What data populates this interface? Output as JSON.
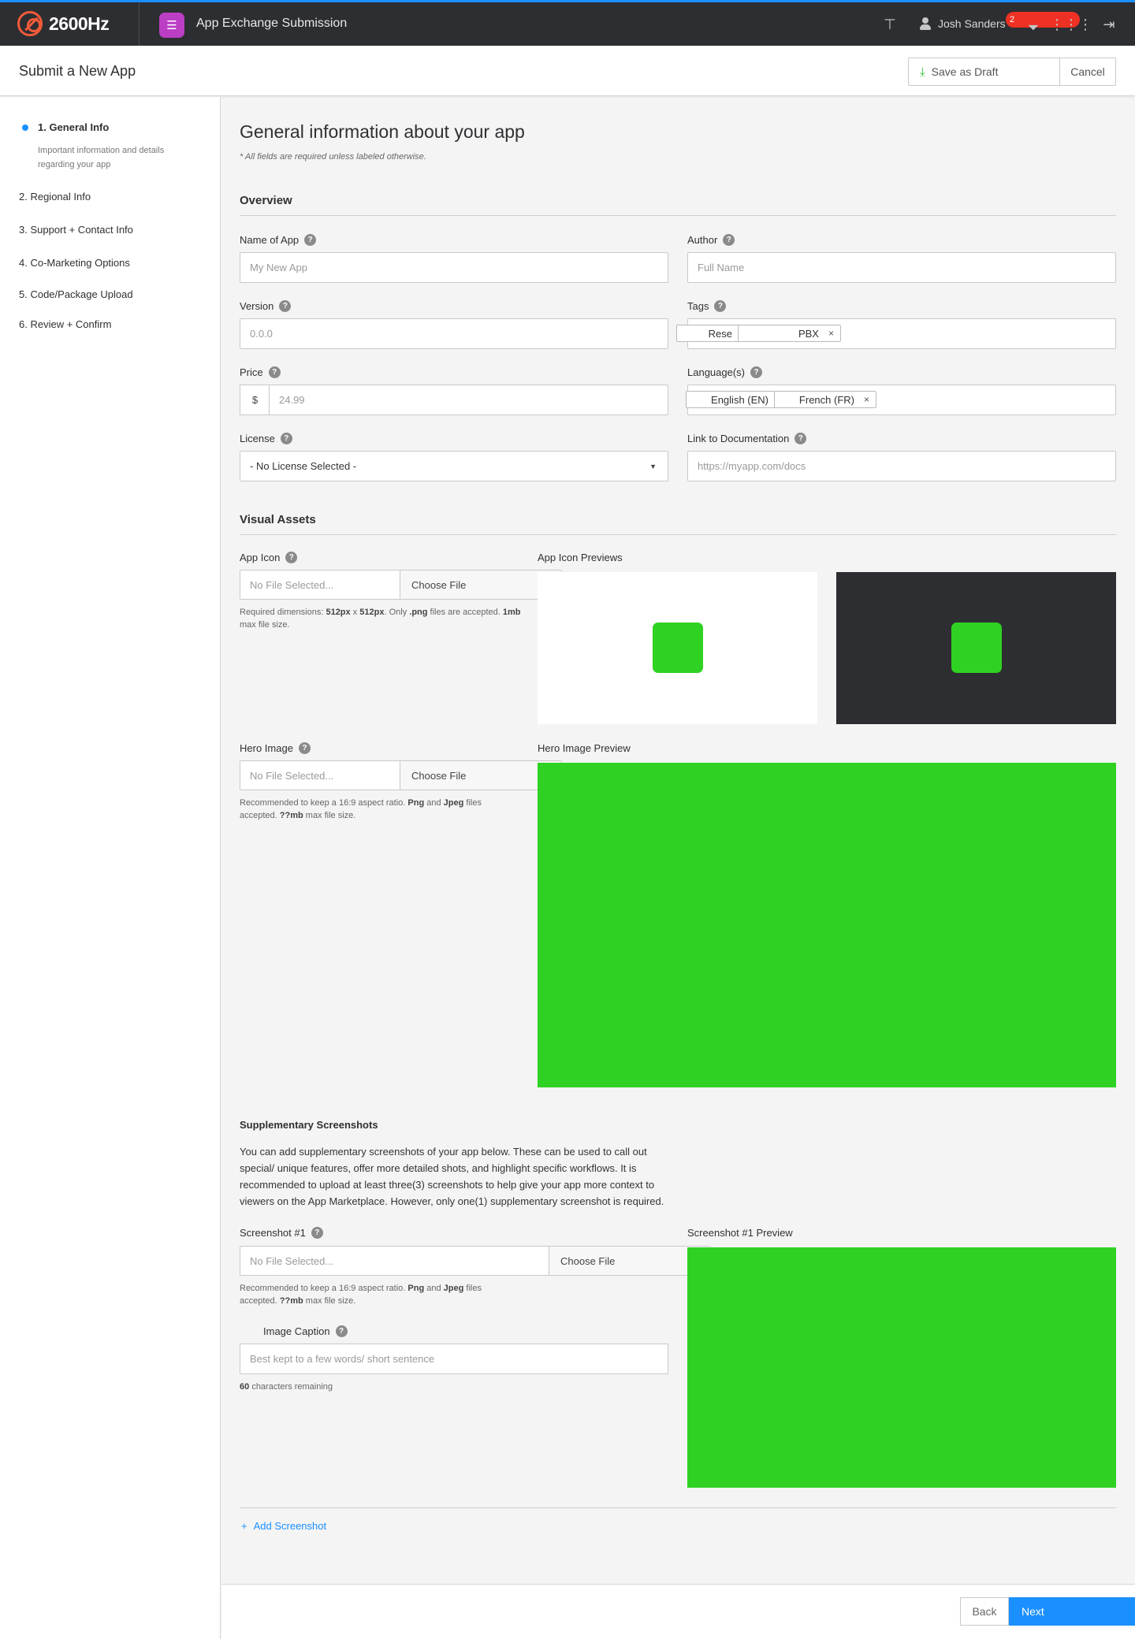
{
  "topbar": {
    "logo_text": "2600Hz",
    "app_title": "App Exchange Submission",
    "user_name": "Josh Sanders",
    "notification_count": "2"
  },
  "subheader": {
    "title": "Submit a New App",
    "save_draft": "Save as Draft",
    "cancel": "Cancel"
  },
  "steps": [
    {
      "label": "1. General Info",
      "description": "Important information and details regarding your app"
    },
    {
      "label": "2. Regional Info"
    },
    {
      "label": "3. Support + Contact Info"
    },
    {
      "label": "4. Co-Marketing Options"
    },
    {
      "label": "5. Code/Package Upload"
    },
    {
      "label": "6. Review + Confirm"
    }
  ],
  "main": {
    "title": "General information about your app",
    "note": "* All fields are required unless labeled otherwise."
  },
  "overview": {
    "heading": "Overview",
    "name_label": "Name of App",
    "name_placeholder": "My New App",
    "author_label": "Author",
    "author_placeholder": "Full Name",
    "version_label": "Version",
    "version_placeholder": "0.0.0",
    "tags_label": "Tags",
    "tags": [
      "Rese",
      "PBX"
    ],
    "price_label": "Price",
    "price_prefix": "$",
    "price_placeholder": "24.99",
    "languages_label": "Language(s)",
    "languages": [
      "English (EN)",
      "French (FR)"
    ],
    "license_label": "License",
    "license_value": "- No License Selected -",
    "docs_label": "Link to Documentation",
    "docs_placeholder": "https://myapp.com/docs"
  },
  "visual": {
    "heading": "Visual Assets",
    "app_icon_label": "App Icon",
    "no_file": "No File Selected...",
    "choose_file": "Choose File",
    "app_icon_previews_label": "App Icon Previews",
    "hero_label": "Hero Image",
    "hero_preview_label": "Hero Image Preview",
    "preview_color": "#2fd222"
  },
  "supplementary": {
    "heading": "Supplementary Screenshots",
    "description": "You can add supplementary screenshots of your app below. These can be used to call out special/ unique features,  offer more detailed shots, and highlight specific workflows. It is recommended to upload at least three(3) screenshots to help give your app more context to viewers on the App Marketplace. However, only one(1) supplementary screenshot is required.",
    "screenshot_label": "Screenshot #1",
    "screenshot_preview_label": "Screenshot #1 Preview",
    "caption_label": "Image Caption",
    "caption_placeholder": "Best kept to a few words/ short sentence",
    "chars_remaining_count": "60",
    "chars_remaining_text": "characters remaining",
    "add_screenshot": "Add Screenshot"
  },
  "footer": {
    "back": "Back",
    "next": "Next"
  }
}
